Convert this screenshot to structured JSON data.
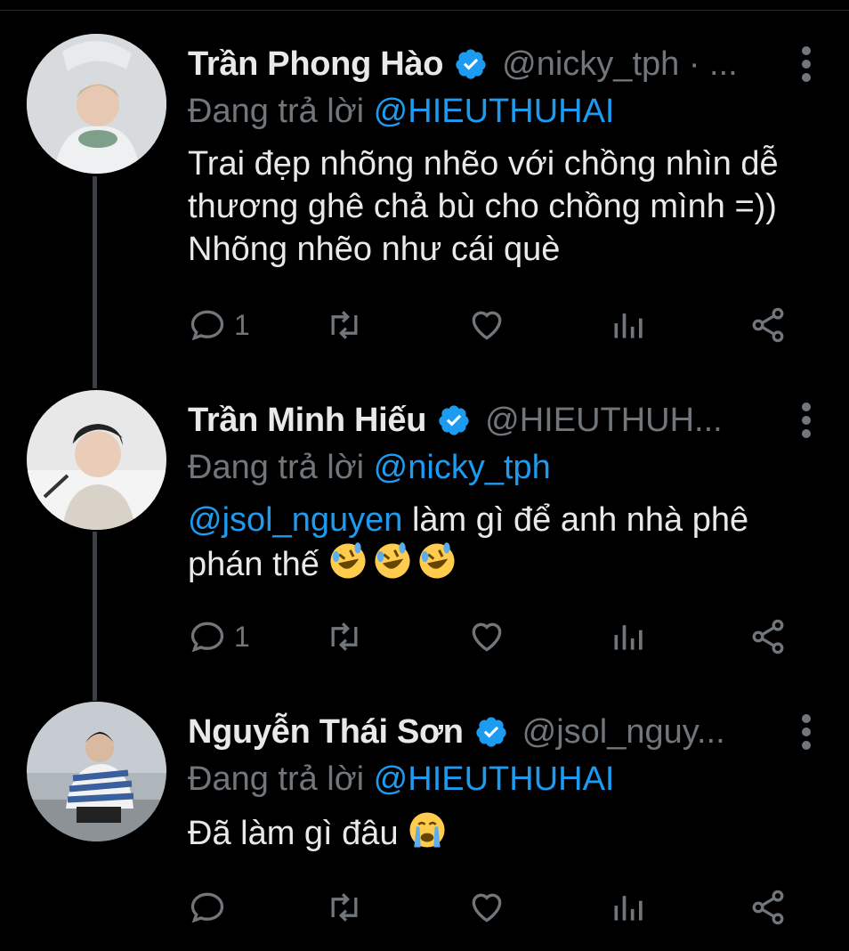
{
  "colors": {
    "background": "#000000",
    "text": "#e7e9ea",
    "muted": "#71767b",
    "accent": "#1d9bf0",
    "thread_line": "#3b3f43"
  },
  "tweets": [
    {
      "name": "Trần Phong Hào",
      "handle": "@nicky_tph · ...",
      "replying_prefix": "Đang trả lời",
      "replying_to": "@HIEUTHUHAI",
      "text": "Trai đẹp nhõng nhẽo với chồng nhìn dễ thương ghê chả bù cho chồng mình =)) Nhõng nhẽo như cái què",
      "reply_count": "1"
    },
    {
      "name": "Trần Minh Hiếu",
      "handle": "@HIEUTHUH...",
      "replying_prefix": "Đang trả lời",
      "replying_to": "@nicky_tph",
      "text_mention": "@jsol_nguyen",
      "text": " làm gì để anh nhà phê phán thế",
      "emoji": [
        "rolling-on-floor-laughing",
        "rolling-on-floor-laughing",
        "rolling-on-floor-laughing"
      ],
      "reply_count": "1"
    },
    {
      "name": "Nguyễn Thái Sơn",
      "handle": "@jsol_nguy...",
      "replying_prefix": "Đang trả lời",
      "replying_to": "@HIEUTHUHAI",
      "text": "Đã làm gì đâu",
      "emoji": [
        "loudly-crying-face"
      ],
      "reply_count": ""
    }
  ]
}
